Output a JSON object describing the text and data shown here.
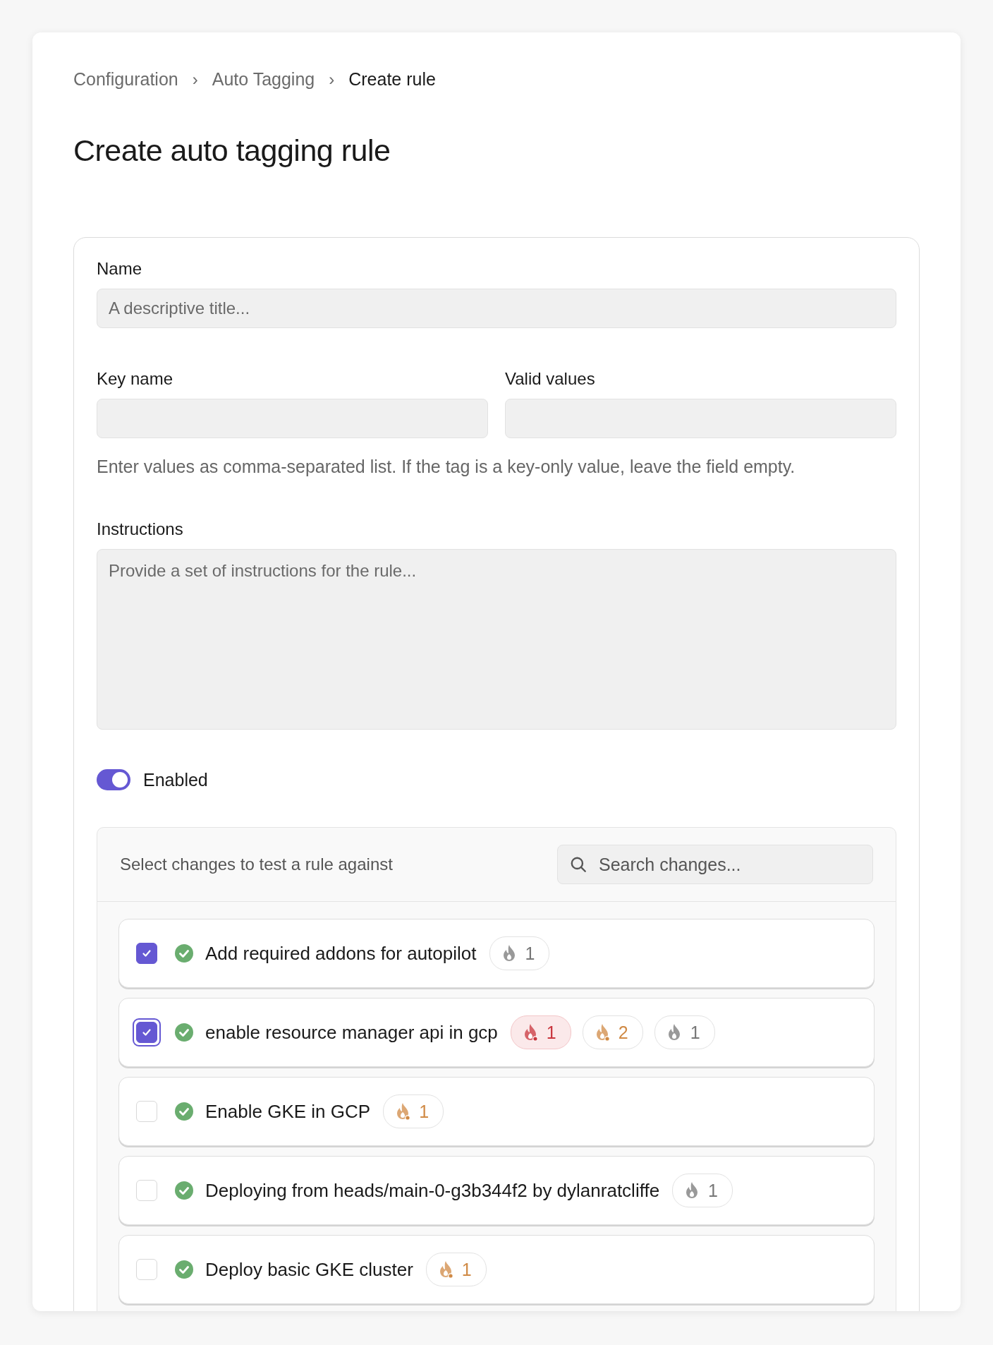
{
  "breadcrumb": [
    {
      "label": "Configuration",
      "current": false
    },
    {
      "label": "Auto Tagging",
      "current": false
    },
    {
      "label": "Create rule",
      "current": true
    }
  ],
  "breadcrumb_separator": "›",
  "title": "Create auto tagging rule",
  "form": {
    "name": {
      "label": "Name",
      "placeholder": "A descriptive title..."
    },
    "key_name": {
      "label": "Key name"
    },
    "valid_values": {
      "label": "Valid values"
    },
    "help": "Enter values as comma-separated list. If the tag is a key-only value, leave the field empty.",
    "instructions": {
      "label": "Instructions",
      "placeholder": "Provide a set of instructions for the rule..."
    },
    "enabled": {
      "label": "Enabled",
      "on": true
    }
  },
  "changes": {
    "title": "Select changes to test a rule against",
    "search": {
      "placeholder": "Search changes..."
    },
    "rows": [
      {
        "title": "Add required addons for autopilot",
        "checked": true,
        "focused": false,
        "badges": [
          {
            "kind": "low",
            "count": "1"
          }
        ]
      },
      {
        "title": "enable resource manager api in gcp",
        "checked": true,
        "focused": true,
        "badges": [
          {
            "kind": "high",
            "count": "1"
          },
          {
            "kind": "medium",
            "count": "2"
          },
          {
            "kind": "low",
            "count": "1"
          }
        ]
      },
      {
        "title": "Enable GKE in GCP",
        "checked": false,
        "focused": false,
        "badges": [
          {
            "kind": "medium",
            "count": "1"
          }
        ]
      },
      {
        "title": "Deploying from heads/main-0-g3b344f2 by dylanratcliffe",
        "checked": false,
        "focused": false,
        "badges": [
          {
            "kind": "low",
            "count": "1"
          }
        ]
      },
      {
        "title": "Deploy basic GKE cluster",
        "checked": false,
        "focused": false,
        "badges": [
          {
            "kind": "medium",
            "count": "1"
          }
        ]
      }
    ]
  }
}
